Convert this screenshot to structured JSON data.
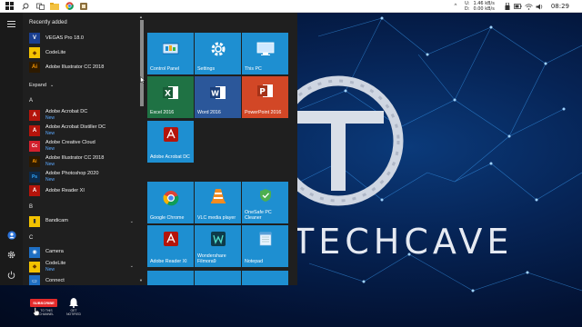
{
  "taskbar": {
    "network": {
      "upload_label": "U:",
      "upload_value": "1.46 kB/s",
      "download_label": "D:",
      "download_value": "0.00 kB/s"
    },
    "clock": "08:29",
    "pinned_icons": [
      "search-icon",
      "task-view-icon",
      "file-explorer-icon",
      "chrome-icon",
      "app-icon"
    ]
  },
  "start_menu": {
    "recently_added_heading": "Recently added",
    "recently_added": [
      {
        "name": "VEGAS Pro 18.0",
        "icon": "vegas-icon",
        "color": "#1a3f8f",
        "glyph": "V"
      },
      {
        "name": "CodeLite",
        "icon": "codelite-icon",
        "color": "#f2c200",
        "glyph": "◆"
      },
      {
        "name": "Adobe Illustrator CC 2018",
        "icon": "illustrator-icon",
        "color": "#2d1a00",
        "glyph": "Ai"
      }
    ],
    "expand_label": "Expand",
    "groups": [
      {
        "letter": "A",
        "items": [
          {
            "name": "Adobe Acrobat DC",
            "badge": "New",
            "icon": "acrobat-icon",
            "color": "#b5140b",
            "glyph": "A"
          },
          {
            "name": "Adobe Acrobat Distiller DC",
            "badge": "New",
            "icon": "acrobat-distiller-icon",
            "color": "#b5140b",
            "glyph": "A"
          },
          {
            "name": "Adobe Creative Cloud",
            "badge": "New",
            "icon": "creative-cloud-icon",
            "color": "#d3202d",
            "glyph": "Cc"
          },
          {
            "name": "Adobe Illustrator CC 2018",
            "badge": "New",
            "icon": "illustrator-icon",
            "color": "#2d1a00",
            "glyph": "Ai"
          },
          {
            "name": "Adobe Photoshop 2020",
            "badge": "New",
            "icon": "photoshop-icon",
            "color": "#0d2a4a",
            "glyph": "Ps"
          },
          {
            "name": "Adobe Reader XI",
            "badge": "",
            "icon": "reader-icon",
            "color": "#b5140b",
            "glyph": "A"
          }
        ]
      },
      {
        "letter": "B",
        "items": [
          {
            "name": "Bandicam",
            "badge": "",
            "icon": "bandicam-icon",
            "color": "#6a6a6a",
            "glyph": "▮",
            "expandable": true
          }
        ]
      },
      {
        "letter": "C",
        "items": [
          {
            "name": "Camera",
            "badge": "",
            "icon": "camera-icon",
            "color": "#1e6fc4",
            "glyph": "◉"
          },
          {
            "name": "CodeLite",
            "badge": "New",
            "icon": "codelite-icon",
            "color": "#f2c200",
            "glyph": "◆",
            "expandable": true
          },
          {
            "name": "Connect",
            "badge": "",
            "icon": "connect-icon",
            "color": "#1e6fc4",
            "glyph": "▭"
          }
        ]
      }
    ],
    "tiles": [
      {
        "label": "Control Panel",
        "icon": "control-panel-icon",
        "color": "#1e8fd1"
      },
      {
        "label": "Settings",
        "icon": "settings-gear-icon",
        "color": "#1e8fd1"
      },
      {
        "label": "This PC",
        "icon": "this-pc-icon",
        "color": "#1e8fd1"
      },
      {
        "label": "Excel 2016",
        "icon": "excel-icon",
        "color": "#1f7244"
      },
      {
        "label": "Word 2016",
        "icon": "word-icon",
        "color": "#2b579a"
      },
      {
        "label": "PowerPoint 2016",
        "icon": "powerpoint-icon",
        "color": "#d24726"
      },
      {
        "label": "Adobe Acrobat DC",
        "icon": "acrobat-icon",
        "color": "#1e8fd1"
      },
      {
        "label": "Google Chrome",
        "icon": "chrome-icon",
        "color": "#1e8fd1"
      },
      {
        "label": "VLC media player",
        "icon": "vlc-icon",
        "color": "#1e8fd1"
      },
      {
        "label": "OneSafe PC Cleaner",
        "icon": "onesafe-icon",
        "color": "#1e8fd1"
      },
      {
        "label": "Adobe Reader XI",
        "icon": "reader-icon",
        "color": "#1e8fd1"
      },
      {
        "label": "Wondershare Filmora9",
        "icon": "filmora-icon",
        "color": "#1e8fd1"
      },
      {
        "label": "Notepad",
        "icon": "notepad-icon",
        "color": "#1e8fd1"
      }
    ]
  },
  "desktop": {
    "brand": "TECHCAVE"
  },
  "overlay": {
    "subscribe_label": "SUBSCRIBE",
    "subscribe_caption": "TO THIS CHANNEL",
    "bell_caption": "GET NOTIFIED"
  }
}
